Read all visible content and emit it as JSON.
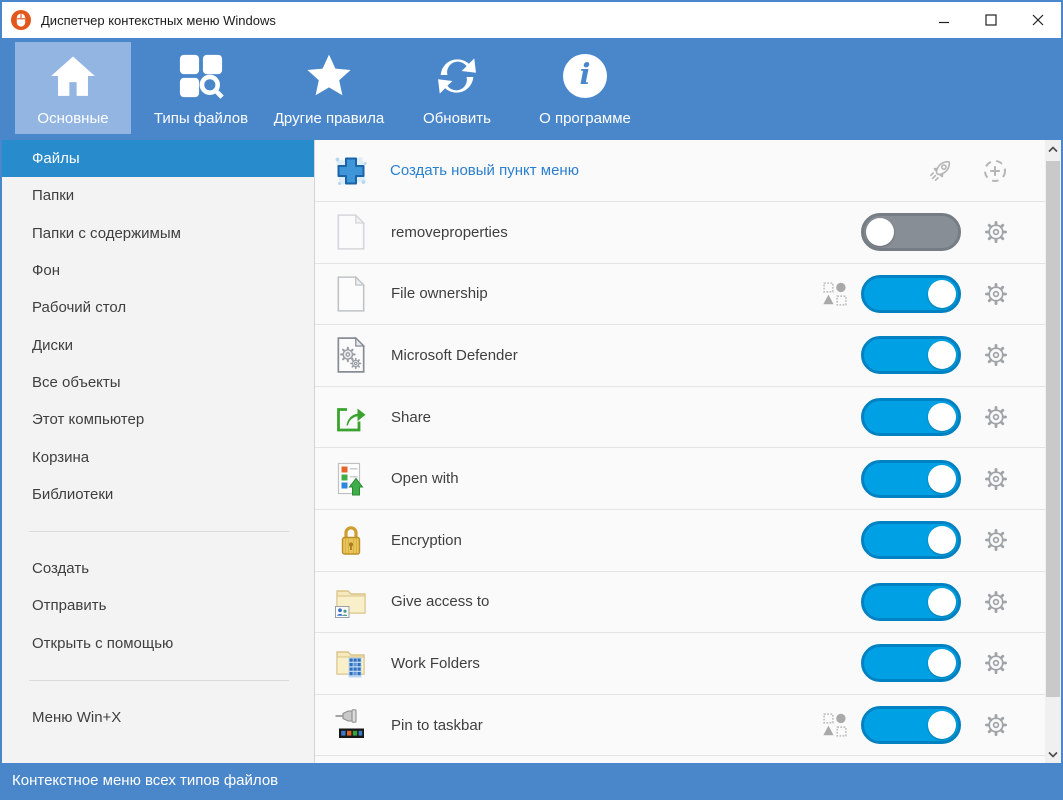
{
  "window": {
    "title": "Диспетчер контекстных меню Windows"
  },
  "toolbar": {
    "info_glyph": "i",
    "items": [
      {
        "label": "Основные",
        "icon": "home",
        "selected": true
      },
      {
        "label": "Типы файлов",
        "icon": "file-types",
        "selected": false
      },
      {
        "label": "Другие правила",
        "icon": "star",
        "selected": false
      },
      {
        "label": "Обновить",
        "icon": "refresh",
        "selected": false
      },
      {
        "label": "О программе",
        "icon": "info",
        "selected": false
      }
    ]
  },
  "sidebar": {
    "items": [
      {
        "label": "Файлы",
        "selected": true
      },
      {
        "label": "Папки",
        "selected": false
      },
      {
        "label": "Папки с содержимым",
        "selected": false
      },
      {
        "label": "Фон",
        "selected": false
      },
      {
        "label": "Рабочий стол",
        "selected": false
      },
      {
        "label": "Диски",
        "selected": false
      },
      {
        "label": "Все объекты",
        "selected": false
      },
      {
        "label": "Этот компьютер",
        "selected": false
      },
      {
        "label": "Корзина",
        "selected": false
      },
      {
        "label": "Библиотеки",
        "selected": false
      },
      {
        "label": "Создать",
        "selected": false
      },
      {
        "label": "Отправить",
        "selected": false
      },
      {
        "label": "Открыть с помощью",
        "selected": false
      },
      {
        "label": "Меню Win+X",
        "selected": false
      }
    ]
  },
  "content": {
    "create_new_label": "Создать новый пункт меню",
    "rows": [
      {
        "label": "removeproperties",
        "icon": "document",
        "enabled": false,
        "type_badge": false
      },
      {
        "label": "File ownership",
        "icon": "document",
        "enabled": true,
        "type_badge": true
      },
      {
        "label": "Microsoft Defender",
        "icon": "document-gears",
        "enabled": true,
        "type_badge": false
      },
      {
        "label": "Share",
        "icon": "share",
        "enabled": true,
        "type_badge": false
      },
      {
        "label": "Open with",
        "icon": "open-with",
        "enabled": true,
        "type_badge": false
      },
      {
        "label": "Encryption",
        "icon": "lock",
        "enabled": true,
        "type_badge": false
      },
      {
        "label": "Give access to",
        "icon": "folder-users",
        "enabled": true,
        "type_badge": false
      },
      {
        "label": "Work Folders",
        "icon": "folder-building",
        "enabled": true,
        "type_badge": false
      },
      {
        "label": "Pin to taskbar",
        "icon": "pin-taskbar",
        "enabled": true,
        "type_badge": true
      }
    ]
  },
  "statusbar": {
    "text": "Контекстное меню всех типов файлов"
  },
  "colors": {
    "toolbar_blue": "#4a87ca",
    "toolbar_selected": "#93b5e2",
    "sidebar_selected": "#288ccc",
    "toggle_on": "#00a1e4",
    "toggle_off": "#878e95",
    "link_blue": "#2b7fd0",
    "statusbar_blue": "#4a87ca"
  }
}
